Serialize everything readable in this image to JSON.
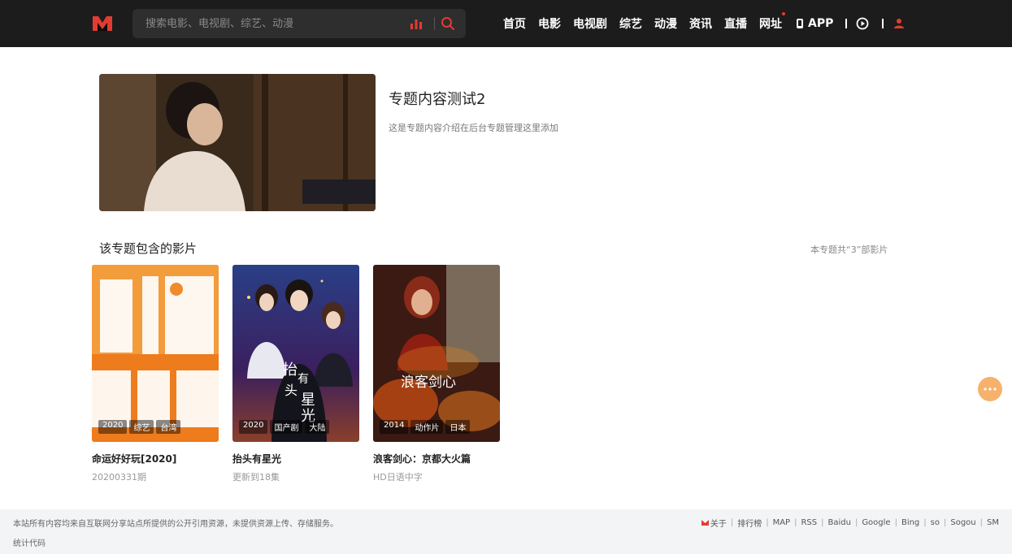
{
  "header": {
    "logo": "site-logo",
    "search_placeholder": "搜索电影、电视剧、综艺、动漫",
    "nav": [
      {
        "label": "首页"
      },
      {
        "label": "电影"
      },
      {
        "label": "电视剧"
      },
      {
        "label": "综艺"
      },
      {
        "label": "动漫"
      },
      {
        "label": "资讯"
      },
      {
        "label": "直播"
      },
      {
        "label": "网址"
      }
    ],
    "app_label": "APP",
    "accent": "#e23c32"
  },
  "topic": {
    "title": "专题内容测试2",
    "description": "这是专题内容介绍在后台专题管理这里添加"
  },
  "section": {
    "title": "该专题包含的影片",
    "count_text": "本专题共“3”部影片"
  },
  "movies": [
    {
      "title": "命运好好玩[2020]",
      "subtitle": "20200331期",
      "year": "2020",
      "tag1": "综艺",
      "tag2": "台湾"
    },
    {
      "title": "抬头有星光",
      "subtitle": "更新到18集",
      "year": "2020",
      "tag1": "国产剧",
      "tag2": "大陆"
    },
    {
      "title": "浪客剑心：京都大火篇",
      "subtitle": "HD日语中字",
      "year": "2014",
      "tag1": "动作片",
      "tag2": "日本"
    }
  ],
  "footer": {
    "copyright": "本站所有内容均来自互联网分享站点所提供的公开引用资源，未提供资源上传、存储服务。",
    "stats": "统计代码",
    "links": [
      {
        "label": "关于"
      },
      {
        "label": "排行榜"
      },
      {
        "label": "MAP"
      },
      {
        "label": "RSS"
      },
      {
        "label": "Baidu"
      },
      {
        "label": "Google"
      },
      {
        "label": "Bing"
      },
      {
        "label": "so"
      },
      {
        "label": "Sogou"
      },
      {
        "label": "SM"
      }
    ]
  }
}
